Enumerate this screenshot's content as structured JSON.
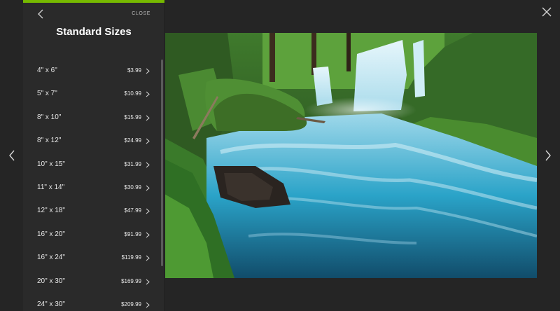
{
  "colors": {
    "accent": "#76b900",
    "background": "#252525",
    "panel": "#2a2a2a"
  },
  "icons": {
    "close": "close-icon",
    "prev": "chevron-left-icon",
    "next": "chevron-right-icon",
    "back": "chevron-left-icon",
    "row": "chevron-right-icon"
  },
  "panel": {
    "close_label": "CLOSE",
    "title": "Standard Sizes",
    "sizes": [
      {
        "label": "4\" x 6\"",
        "price": "$3.99"
      },
      {
        "label": "5\" x 7\"",
        "price": "$10.99"
      },
      {
        "label": "8\" x 10\"",
        "price": "$15.99"
      },
      {
        "label": "8\" x 12\"",
        "price": "$24.99"
      },
      {
        "label": "10\" x 15\"",
        "price": "$31.99"
      },
      {
        "label": "11\" x 14\"",
        "price": "$30.99"
      },
      {
        "label": "12\" x 18\"",
        "price": "$47.99"
      },
      {
        "label": "16\" x 20\"",
        "price": "$91.99"
      },
      {
        "label": "16\" x 24\"",
        "price": "$119.99"
      },
      {
        "label": "20\" x 30\"",
        "price": "$169.99"
      },
      {
        "label": "24\" x 30\"",
        "price": "$209.99"
      }
    ]
  }
}
